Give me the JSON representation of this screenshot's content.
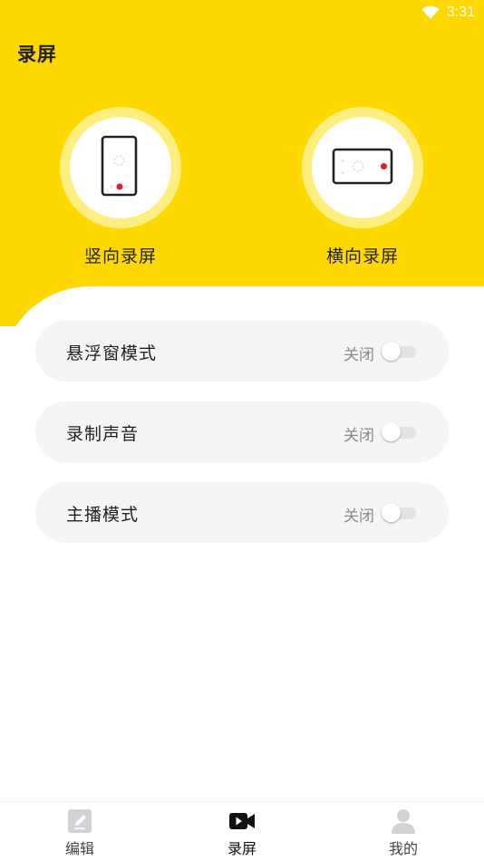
{
  "status_bar": {
    "time": "3:31"
  },
  "header": {
    "title": "录屏"
  },
  "modes": [
    {
      "label": "竖向录屏",
      "icon": "portrait-phone-icon"
    },
    {
      "label": "横向录屏",
      "icon": "landscape-phone-icon"
    }
  ],
  "settings": [
    {
      "label": "悬浮窗模式",
      "state": "关闭",
      "enabled": false
    },
    {
      "label": "录制声音",
      "state": "关闭",
      "enabled": false
    },
    {
      "label": "主播模式",
      "state": "关闭",
      "enabled": false
    }
  ],
  "bottom_nav": {
    "items": [
      {
        "label": "编辑",
        "icon": "edit-icon",
        "active": false
      },
      {
        "label": "录屏",
        "icon": "video-camera-icon",
        "active": true
      },
      {
        "label": "我的",
        "icon": "person-icon",
        "active": false
      }
    ]
  },
  "colors": {
    "brand": "#FFD800",
    "ring": "#FFEE80",
    "record_dot": "#E8192C",
    "row_background": "#F5F5F7"
  }
}
